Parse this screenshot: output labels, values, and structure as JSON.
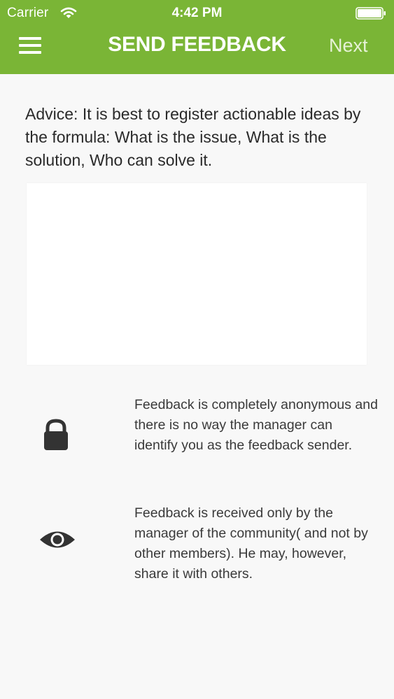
{
  "status_bar": {
    "carrier": "Carrier",
    "time": "4:42 PM",
    "wifi_icon": "wifi-icon",
    "battery_icon": "battery-icon"
  },
  "nav": {
    "menu_icon": "hamburger-menu-icon",
    "title": "SEND FEEDBACK",
    "next_label": "Next"
  },
  "advice": "Advice: It is best to register actionable ideas by the formula: What is the issue, What is the solution, Who can solve it.",
  "feedback_field": {
    "value": "",
    "placeholder": ""
  },
  "info": [
    {
      "icon": "lock-icon",
      "text": "Feedback is completely anonymous and there is no way the manager can identify you as the feedback sender."
    },
    {
      "icon": "eye-icon",
      "text": "Feedback is received only by the manager of the community( and not by other members). He may, however, share it with others."
    }
  ],
  "colors": {
    "header": "#7ab536",
    "header_text": "#ffffff",
    "background": "#f8f8f8",
    "icon": "#333333"
  }
}
